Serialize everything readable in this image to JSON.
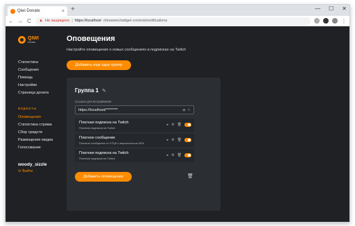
{
  "browser": {
    "tab_title": "Qiwi Donate",
    "tab_close": "×",
    "new_tab": "+",
    "win_min": "—",
    "win_max": "☐",
    "win_close": "✕",
    "nav_back": "←",
    "nav_forward": "→",
    "nav_reload": "C",
    "warning_icon": "▲",
    "insecure_label": "Не защищено",
    "separator": "|",
    "url_host": "https://localhost",
    "url_path": "/streamer/widget-controls/notifications",
    "menu_icon": "⋮",
    "colors": {
      "ext1": "#aaaaaa",
      "ext2": "#333333",
      "ext3": "#888888"
    }
  },
  "sidebar": {
    "logo_main": "QIWI",
    "logo_sub": "Donate",
    "items": [
      {
        "label": "Статистика"
      },
      {
        "label": "Сообщения"
      },
      {
        "label": "Помощь"
      },
      {
        "label": "Настройки"
      },
      {
        "label": "Страница доната"
      }
    ],
    "widgets_section": "ВИДЖЕТЫ",
    "widget_items": [
      {
        "label": "Оповещения",
        "active": true
      },
      {
        "label": "Статистика стрима"
      },
      {
        "label": "Сбор средств"
      },
      {
        "label": "Размещение медиа"
      },
      {
        "label": "Голосование"
      }
    ],
    "user_name": "woody_sizzle",
    "logout_icon": "⊖",
    "logout_label": "Выйти"
  },
  "main": {
    "title": "Оповещения",
    "description": "Настройте оповещения о новых сообщениях и подписках на Twitch",
    "add_group_label": "Добавить еще одну группу",
    "group": {
      "title": "Группа 1",
      "edit_icon": "✎",
      "embed_label": "Ссылка для встраивания",
      "embed_value": "https://localhost/********",
      "eye_icon": "◉",
      "refresh_icon": "↻",
      "alerts": [
        {
          "title": "Платная подписка на Twitch",
          "subtitle": "Платная подписка на Twitch",
          "enabled": true
        },
        {
          "title": "Платное сообщение",
          "subtitle": "Платное сообщение от 0 Руб с вероятностью 50%",
          "enabled": true
        },
        {
          "title": "Платная подписка на Twitch",
          "subtitle": "Платная подписка на Twitch",
          "enabled": true
        }
      ],
      "row_play_icon": "▸",
      "row_gear_icon": "⚙",
      "row_trash_icon": "🗑",
      "add_alert_label": "Добавить оповещение",
      "group_trash_icon": "🗑"
    }
  },
  "colors": {
    "accent": "#ff8c00",
    "background": "#1f2125",
    "card": "#2b2e33"
  }
}
